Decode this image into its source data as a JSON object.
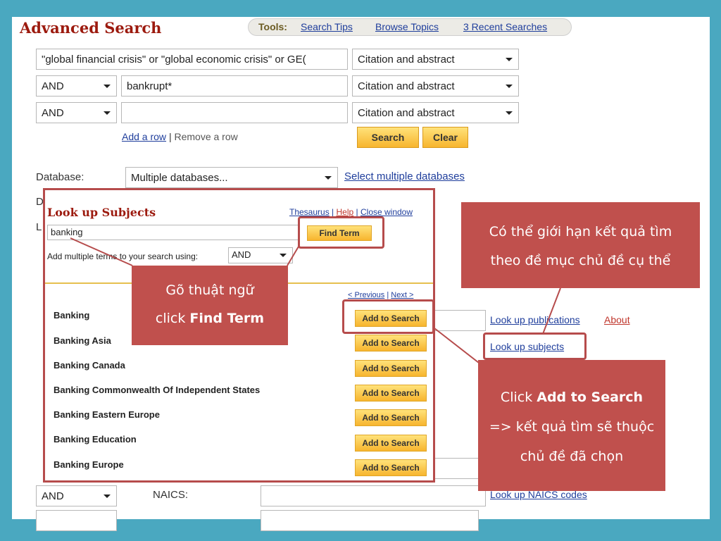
{
  "page": {
    "title": "Advanced Search",
    "tools": {
      "label": "Tools:",
      "search_tips": "Search Tips",
      "browse_topics": "Browse Topics",
      "recent_searches": "3 Recent Searches"
    }
  },
  "search_rows": [
    {
      "operator": "",
      "term": "\"global financial crisis\" or \"global economic crisis\" or GE(",
      "field": "Citation and abstract"
    },
    {
      "operator": "AND",
      "term": "bankrupt*",
      "field": "Citation and abstract"
    },
    {
      "operator": "AND",
      "term": "",
      "field": "Citation and abstract"
    }
  ],
  "row_actions": {
    "add_row": "Add a row",
    "separator": "|",
    "remove_row": "Remove a row"
  },
  "buttons": {
    "search": "Search",
    "clear": "Clear"
  },
  "database": {
    "label": "Database:",
    "selected": "Multiple databases...",
    "select_multiple_link": "Select multiple databases"
  },
  "lookup_popup": {
    "title": "Look up Subjects",
    "links": {
      "thesaurus": "Thesaurus",
      "help": "Help",
      "close": "Close window"
    },
    "search_value": "banking",
    "find_term_button": "Find Term",
    "multiple_terms_label": "Add multiple terms to your search using:",
    "multiple_terms_operator": "AND",
    "pagination": {
      "previous": "< Previous",
      "next": "Next >"
    },
    "add_button_label": "Add to Search",
    "results": [
      "Banking",
      "Banking Asia",
      "Banking Canada",
      "Banking Commonwealth Of Independent States",
      "Banking Eastern Europe",
      "Banking Education",
      "Banking Europe"
    ]
  },
  "right_links": {
    "lookup_publications": "Look up publications",
    "about": "About",
    "lookup_subjects": "Look up subjects",
    "lookup_naics": "Look up NAICS codes"
  },
  "naics_row": {
    "operator": "AND",
    "label": "NAICS:"
  },
  "callouts": {
    "find_term_line1": "Gõ thuật ngữ",
    "find_term_line2_prefix": "click ",
    "find_term_line2_bold": "Find Term",
    "subjects_line1": "Có thể giới hạn kết quả tìm",
    "subjects_line2": "theo đề mục chủ đề cụ thể",
    "add_line1_prefix": "Click ",
    "add_line1_bold": "Add to Search",
    "add_line2": "=> kết quả tìm sẽ thuộc",
    "add_line3": "chủ đề đã chọn"
  },
  "colors": {
    "frame_bg": "#4aa8c0",
    "title_red": "#9c1a0e",
    "callout_bg": "#c0504d",
    "highlight_border": "#b64c4c",
    "link_blue": "#1f3e9c"
  }
}
